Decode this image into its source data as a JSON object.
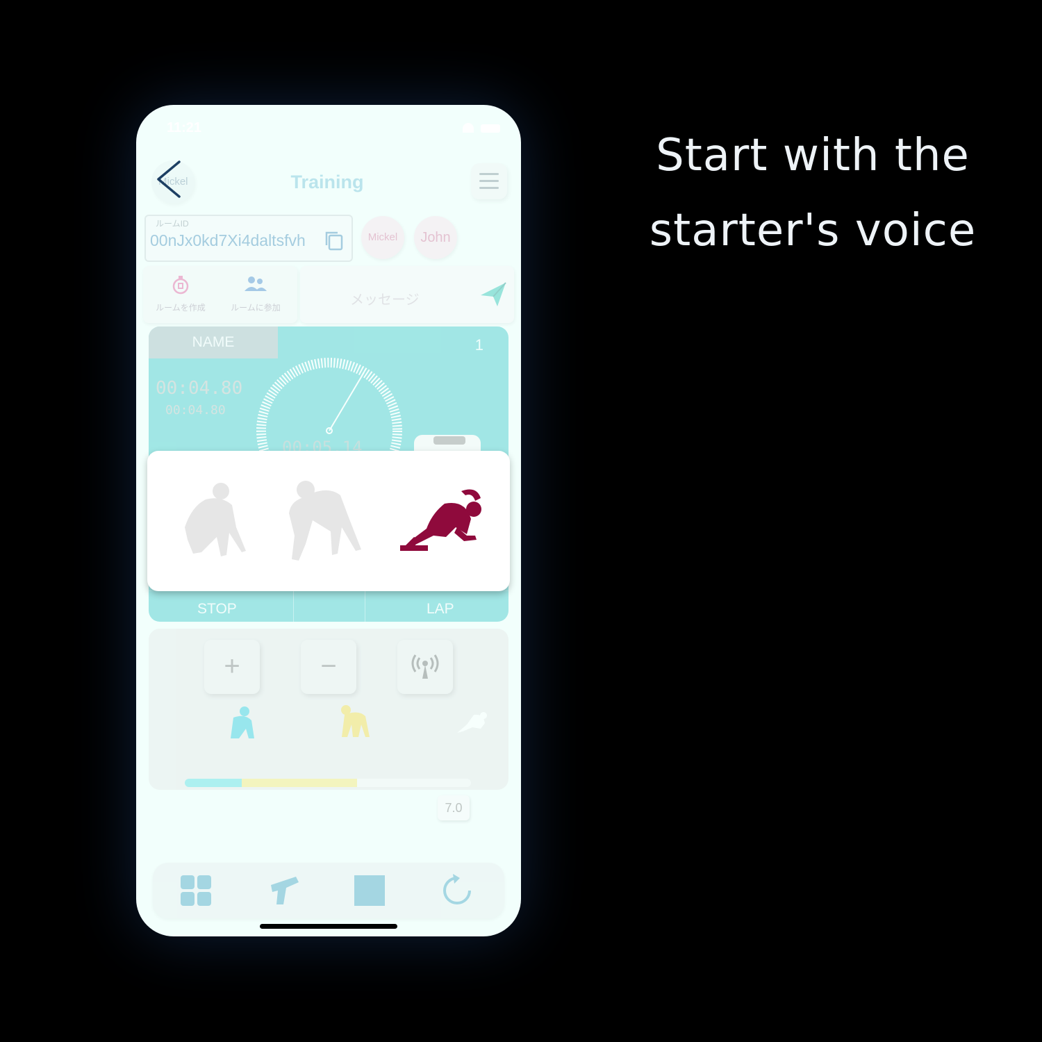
{
  "caption": {
    "line1": "Start with the",
    "line2": "starter's voice"
  },
  "status_bar": {
    "time": "11:21"
  },
  "header": {
    "avatar_name": "Mickel",
    "title": "Training",
    "room_label": "ルームID",
    "room_id": "00nJx0kd7Xi4daltsfvh",
    "members": [
      "Mickel",
      "John"
    ],
    "actions": [
      "ルームを作成",
      "ルームに参加"
    ],
    "message_placeholder": "メッセージ"
  },
  "timer": {
    "name_tab": "NAME",
    "lane_number": "1",
    "main_time": "00:04.80",
    "sub_time": "00:04.80",
    "dial_time": "00:05.14",
    "buttons": [
      "STOP",
      "LAP"
    ]
  },
  "start_stages": {
    "icons": [
      "on-your-marks-figure",
      "set-figure",
      "go-figure"
    ],
    "active_index": 2,
    "colors": {
      "inactive": "#e6e6e6",
      "active": "#8f0a3c"
    }
  },
  "controls": {
    "buttons": [
      "+",
      "−"
    ],
    "antenna_icon": "antenna-icon",
    "slider_value": "7.0",
    "stage_colors": [
      "#4fdde0",
      "#f5e56a",
      "#ffffff"
    ]
  },
  "tabbar": {
    "icons": [
      "grid-icon",
      "starter-pistol-icon",
      "stop-square-icon",
      "reset-icon"
    ]
  },
  "colors": {
    "timer_card": "#33c6c6",
    "title": "#6fc0d8",
    "background": "#000000"
  }
}
